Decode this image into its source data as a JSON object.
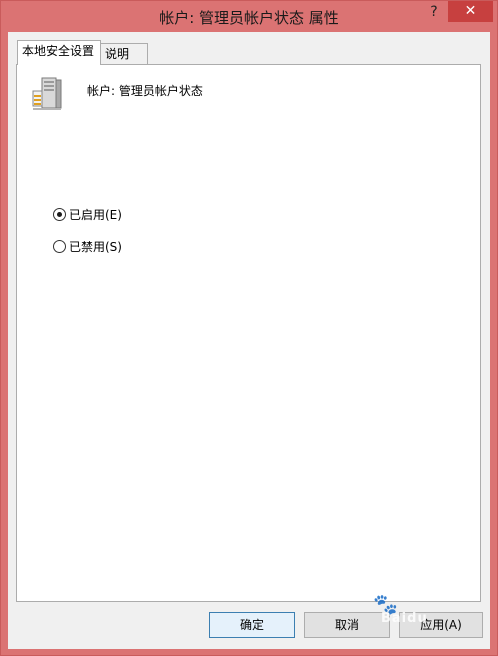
{
  "window": {
    "title": "帐户: 管理员帐户状态 属性",
    "help_label": "?",
    "close_label": "✕"
  },
  "tabs": [
    {
      "label": "本地安全设置",
      "active": true
    },
    {
      "label": "说明",
      "active": false
    }
  ],
  "policy": {
    "name": "帐户: 管理员帐户状态",
    "icon": "server-icon"
  },
  "options": [
    {
      "label": "已启用(E)",
      "selected": true
    },
    {
      "label": "已禁用(S)",
      "selected": false
    }
  ],
  "buttons": {
    "ok": "确定",
    "cancel": "取消",
    "apply": "应用(A)"
  },
  "watermark": "Baidu"
}
